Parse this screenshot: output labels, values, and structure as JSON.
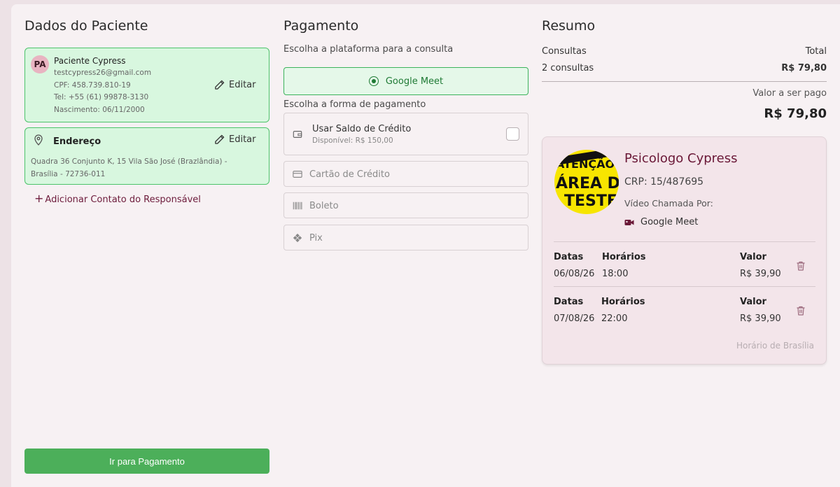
{
  "left": {
    "title": "Dados do Paciente",
    "patient": {
      "initials": "PA",
      "name": "Paciente Cypress",
      "email": "testcypress26@gmail.com",
      "cpf": "CPF: 458.739.810-19",
      "tel": "Tel: +55 (61) 99878-3130",
      "birth": "Nascimento: 06/11/2000",
      "edit_label": "Editar"
    },
    "address": {
      "title": "Endereço",
      "text": "Quadra 36 Conjunto K, 15 Vila São José (Brazlândia) - Brasília - 72736-011",
      "edit_label": "Editar"
    },
    "add_contact": "Adicionar Contato do Responsável",
    "primary_button": "Ir para Pagamento"
  },
  "middle": {
    "title": "Pagamento",
    "platform_label": "Escolha a plataforma para a consulta",
    "platform_selected": "Google Meet",
    "method_label": "Escolha a forma de pagamento",
    "credit": {
      "title": "Usar Saldo de Crédito",
      "available": "Disponível: R$ 150,00"
    },
    "methods": [
      "Cartão de Crédito",
      "Boleto",
      "Pix"
    ]
  },
  "right": {
    "title": "Resumo",
    "col_left": "Consultas",
    "col_right": "Total",
    "count": "2 consultas",
    "total": "R$ 79,80",
    "pay_label": "Valor a ser pago",
    "pay_total": "R$ 79,80",
    "professional": {
      "avatar_text": [
        "ATENÇÃO",
        "ÁREA DE",
        "TESTE"
      ],
      "name": "Psicologo Cypress",
      "crp": "CRP: 15/487695",
      "via_label": "Vídeo Chamada Por:",
      "platform": "Google Meet"
    },
    "appointments": [
      {
        "date_label": "Datas",
        "time_label": "Horários",
        "value_label": "Valor",
        "date": "06/08/26",
        "time": "18:00",
        "value": "R$ 39,90"
      },
      {
        "date_label": "Datas",
        "time_label": "Horários",
        "value_label": "Valor",
        "date": "07/08/26",
        "time": "22:00",
        "value": "R$ 39,90"
      }
    ],
    "timezone": "Horário de Brasília"
  },
  "colors": {
    "brand": "#6a1837",
    "success_bg": "#d8f7df",
    "success_border": "#4cc36a",
    "button": "#4caf5a"
  }
}
